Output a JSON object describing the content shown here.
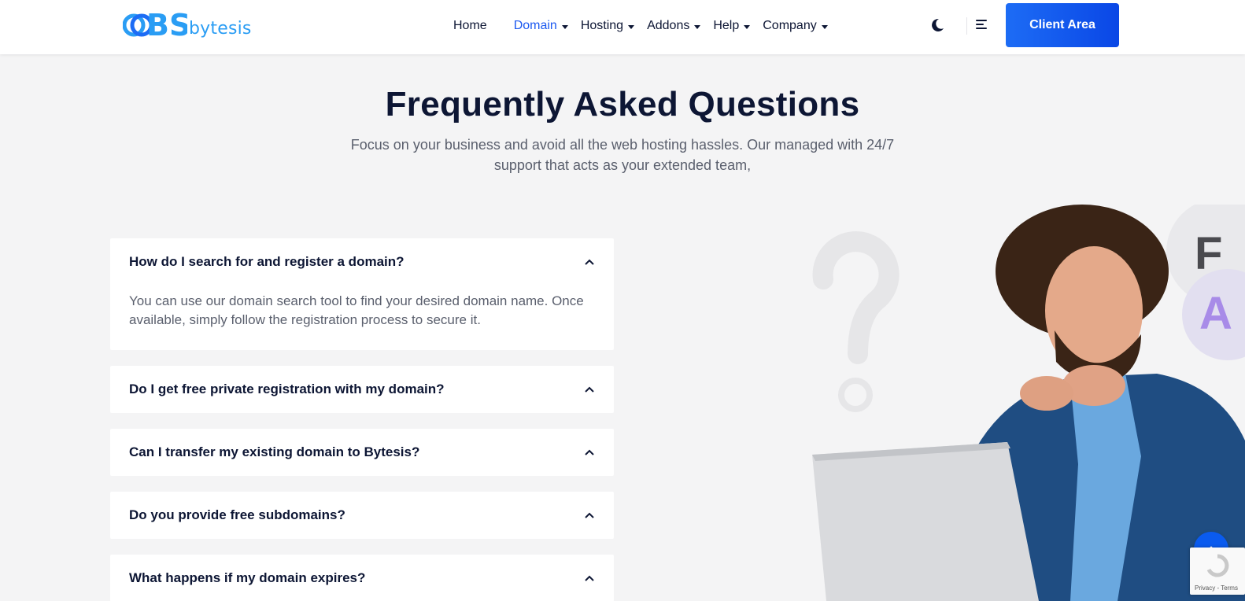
{
  "brand": {
    "logo_letters": "BS",
    "name": "bytesis"
  },
  "nav": {
    "items": [
      {
        "label": "Home",
        "has_dropdown": false,
        "active": false
      },
      {
        "label": "Domain",
        "has_dropdown": true,
        "active": true
      },
      {
        "label": "Hosting",
        "has_dropdown": true,
        "active": false
      },
      {
        "label": "Addons",
        "has_dropdown": true,
        "active": false
      },
      {
        "label": "Help",
        "has_dropdown": true,
        "active": false
      },
      {
        "label": "Company",
        "has_dropdown": true,
        "active": false
      }
    ],
    "theme_icon": "moon-icon",
    "menu_icon": "hamburger-icon",
    "cta_label": "Client Area"
  },
  "faq_section": {
    "title": "Frequently Asked Questions",
    "subtitle": "Focus on your business and avoid all the web hosting hassles. Our managed with 24/7 support that acts as your extended team,",
    "items": [
      {
        "question": "How do I search for and register a domain?",
        "answer": "You can use our domain search tool to find your desired domain name. Once available, simply follow the registration process to secure it.",
        "expanded": true
      },
      {
        "question": "Do I get free private registration with my domain?",
        "answer": "",
        "expanded": false
      },
      {
        "question": "Can I transfer my existing domain to Bytesis?",
        "answer": "",
        "expanded": false
      },
      {
        "question": "Do you provide free subdomains?",
        "answer": "",
        "expanded": false
      },
      {
        "question": "What happens if my domain expires?",
        "answer": "",
        "expanded": false
      }
    ]
  },
  "illustration": {
    "bubble_letters": [
      "F",
      "A"
    ]
  },
  "recaptcha": {
    "text": "Privacy - Terms"
  },
  "colors": {
    "accent": "#1c59f0",
    "button": "#0a47e6",
    "heading": "#0d1634",
    "body_text": "#5a5f6d",
    "logo": "#2a9df4"
  }
}
